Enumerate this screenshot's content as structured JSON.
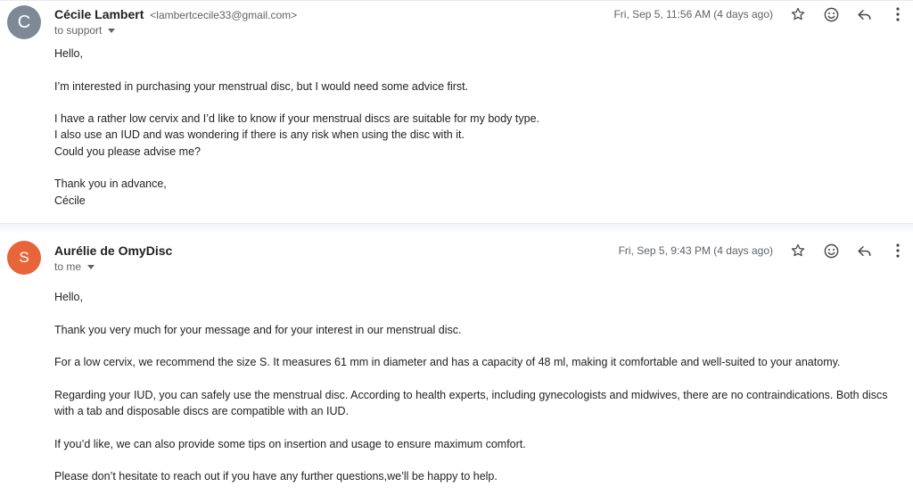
{
  "messages": [
    {
      "avatar_letter": "C",
      "avatar_color": "#7d8a95",
      "sender_name": "Cécile Lambert",
      "sender_email": "<lambertcecile33@gmail.com>",
      "recipient": "to support",
      "date": "Fri, Sep 5, 11:56 AM (4 days ago)",
      "paragraphs": [
        [
          "Hello,"
        ],
        [
          "I’m interested in purchasing your menstrual disc, but I would need some advice first."
        ],
        [
          "I have a rather low cervix and I’d like to know if your menstrual discs are suitable for my body type.",
          "I also use an IUD and was wondering if there is any risk when using the disc with it.",
          "Could you please advise me?"
        ],
        [
          "Thank you in advance,",
          "Cécile"
        ]
      ]
    },
    {
      "avatar_letter": "S",
      "avatar_color": "#e8653a",
      "sender_name": "Aurélie de OmyDisc",
      "recipient": "to me",
      "date": "Fri, Sep 5, 9:43 PM (4 days ago)",
      "paragraphs": [
        [
          "Hello,"
        ],
        [
          "Thank you very much for your message and for your interest in our menstrual disc."
        ],
        [
          "For a low cervix, we recommend the size S. It measures 61 mm in diameter and has a capacity of 48 ml, making it comfortable and well-suited to your anatomy."
        ],
        [
          "Regarding your IUD, you can safely use the menstrual disc. According to health experts, including gynecologists and midwives, there are no contraindications. Both discs with a tab and disposable discs are compatible with an IUD."
        ],
        [
          "If you’d like, we can also provide some tips on insertion and usage to ensure maximum comfort."
        ],
        [
          "Please don’t hesitate to reach out if you have any further questions,we’ll be happy to help."
        ]
      ]
    }
  ],
  "icons": {
    "star": "star-icon",
    "emoji": "emoji-reaction-icon",
    "reply": "reply-icon",
    "more": "more-vert-icon"
  }
}
